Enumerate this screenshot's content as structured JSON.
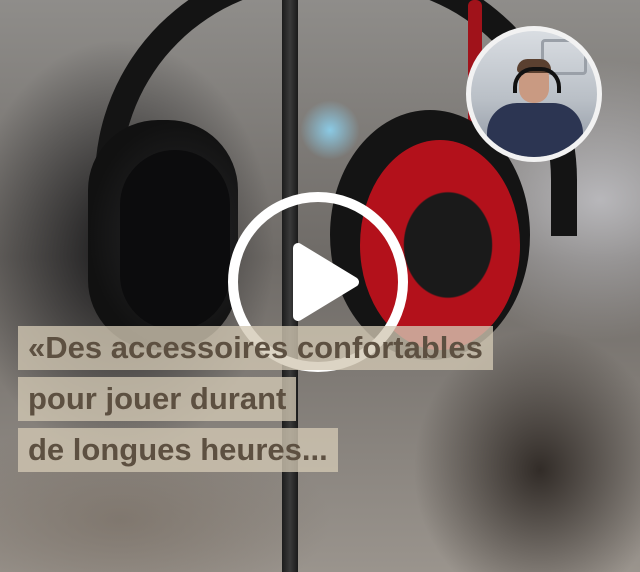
{
  "player": {
    "caption_lines": [
      "«Des accessoires confortables",
      "pour jouer durant",
      "de longues heures..."
    ],
    "play_icon": "play-icon",
    "colors": {
      "play_button": "#ffffff",
      "caption_background": "#d2c8b4",
      "caption_text": "#5d5041",
      "headset_accent": "#b3111b"
    }
  }
}
